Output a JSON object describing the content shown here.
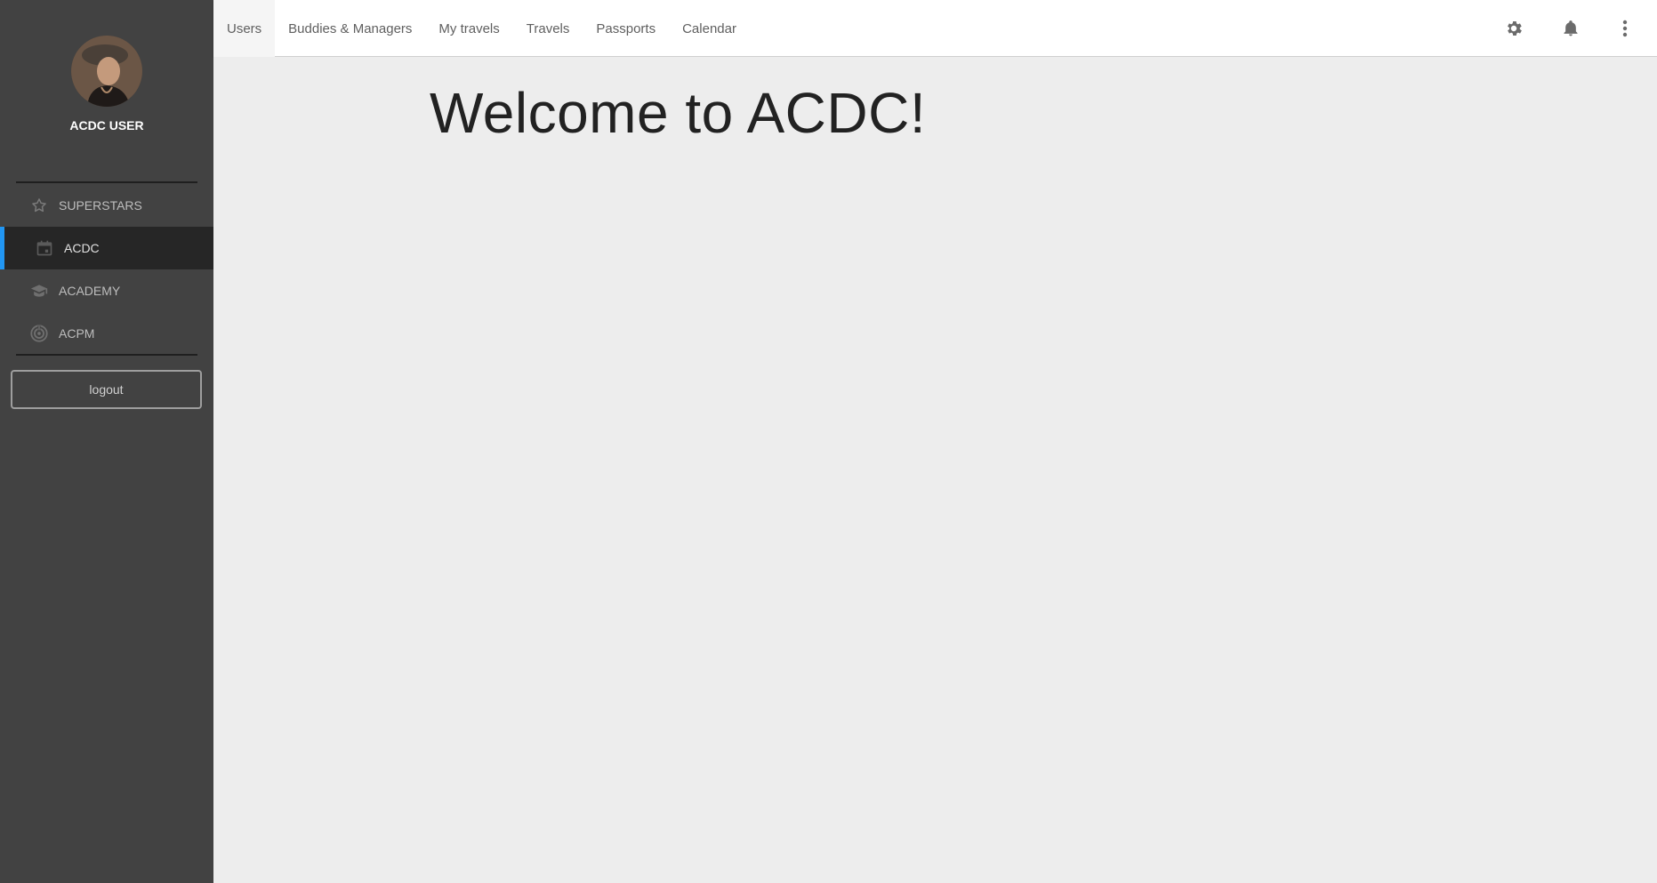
{
  "sidebar": {
    "user_name": "ACDC USER",
    "items": [
      {
        "label": "SUPERSTARS",
        "icon": "star-icon"
      },
      {
        "label": "ACDC",
        "icon": "calendar-icon",
        "active": true
      },
      {
        "label": "ACADEMY",
        "icon": "graduation-cap-icon"
      },
      {
        "label": "ACPM",
        "icon": "target-icon"
      }
    ],
    "logout_label": "logout"
  },
  "topbar": {
    "tabs": [
      {
        "label": "Users",
        "active": true
      },
      {
        "label": "Buddies & Managers"
      },
      {
        "label": "My travels"
      },
      {
        "label": "Travels"
      },
      {
        "label": "Passports"
      },
      {
        "label": "Calendar"
      }
    ],
    "actions": [
      "gear-icon",
      "bell-icon",
      "more-vertical-icon"
    ]
  },
  "main": {
    "heading": "Welcome to ACDC!"
  },
  "colors": {
    "sidebar_bg": "#424242",
    "active_item_bg": "#262626",
    "accent": "#2196f3",
    "main_bg": "#ededed",
    "topbar_bg": "#ffffff"
  }
}
